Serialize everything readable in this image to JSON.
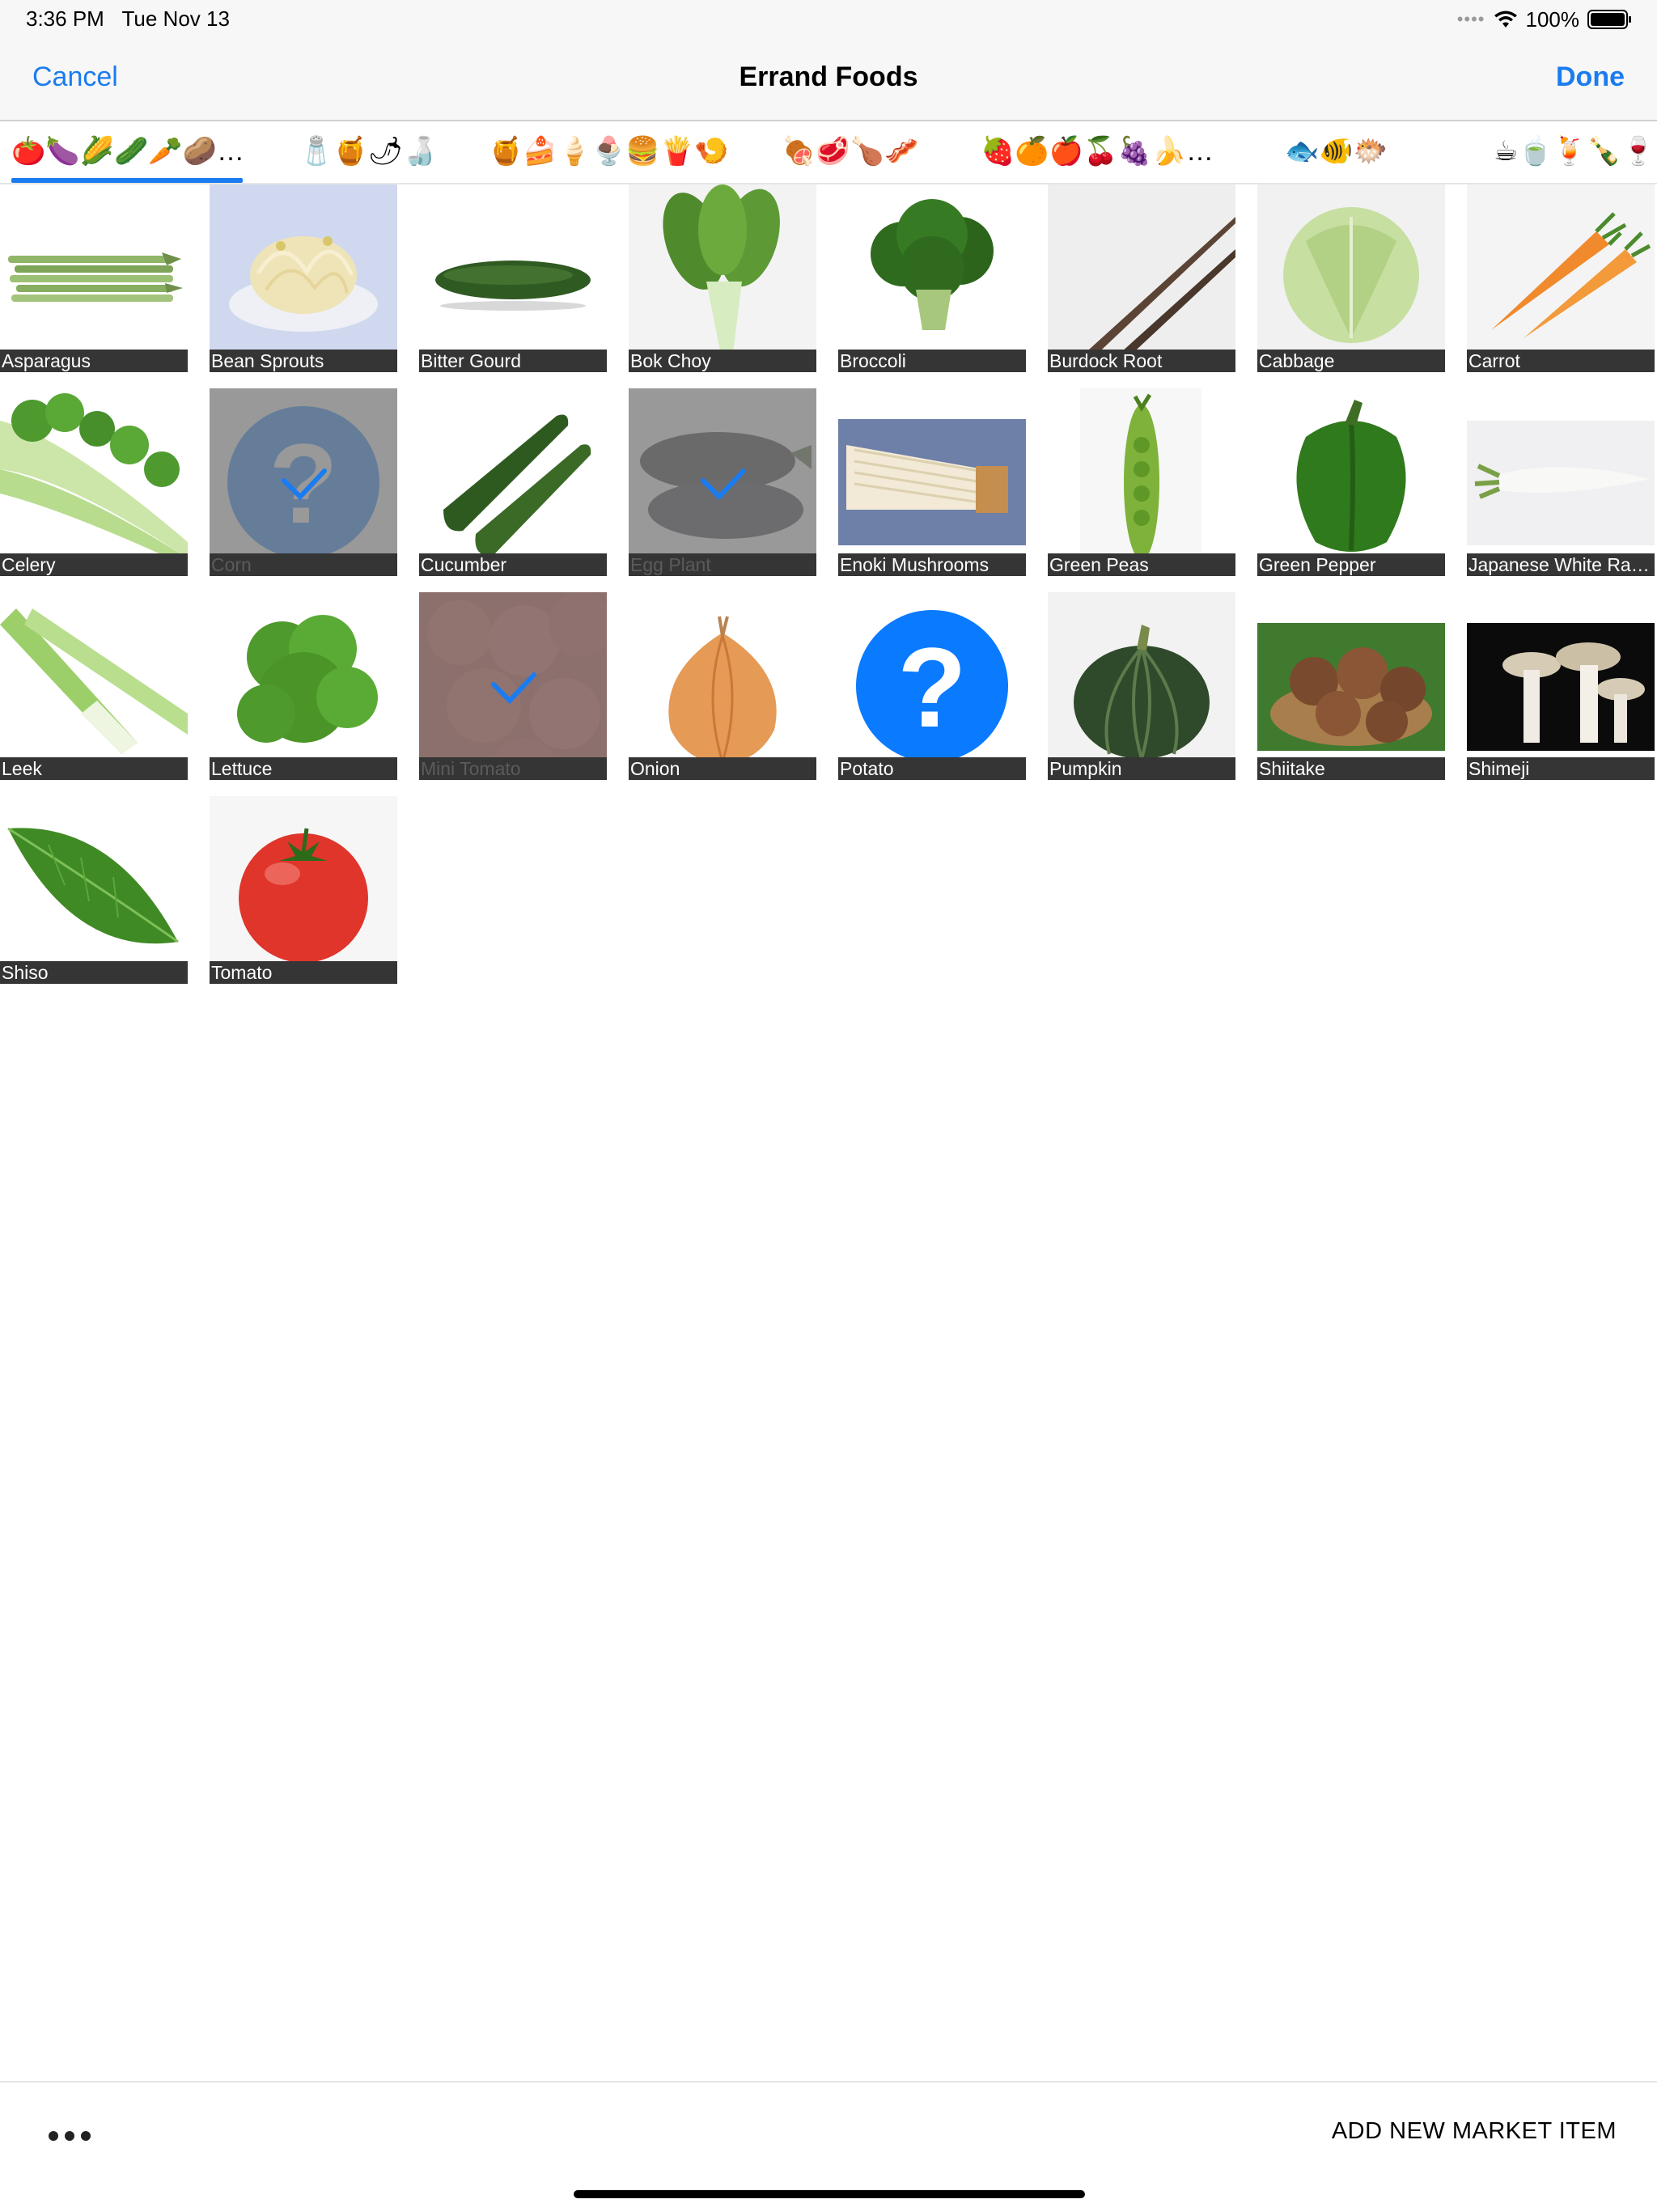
{
  "status": {
    "time": "3:36 PM",
    "date": "Tue Nov 13",
    "battery": "100%"
  },
  "nav": {
    "cancel": "Cancel",
    "title": "Errand Foods",
    "done": "Done"
  },
  "tabs": [
    {
      "label": "🍅🍆🌽🥒🥕🥔…",
      "selected": true
    },
    {
      "label": "🧂🍯🌶🍶"
    },
    {
      "label": "🍯🍰🍦🍨🍔🍟🍤"
    },
    {
      "label": "🍖🥩🍗🥓"
    },
    {
      "label": "🍓🍊🍎🍒🍇🍌…"
    },
    {
      "label": "🐟🐠🐡"
    },
    {
      "label": "☕🍵🍹🍾🍷"
    }
  ],
  "items": [
    {
      "name": "Asparagus",
      "selected": false
    },
    {
      "name": "Bean Sprouts",
      "selected": false
    },
    {
      "name": "Bitter Gourd",
      "selected": false
    },
    {
      "name": "Bok Choy",
      "selected": false
    },
    {
      "name": "Broccoli",
      "selected": false
    },
    {
      "name": "Burdock Root",
      "selected": false
    },
    {
      "name": "Cabbage",
      "selected": false
    },
    {
      "name": "Carrot",
      "selected": false
    },
    {
      "name": "Celery",
      "selected": false
    },
    {
      "name": "Corn",
      "selected": true
    },
    {
      "name": "Cucumber",
      "selected": false
    },
    {
      "name": "Egg Plant",
      "selected": true
    },
    {
      "name": "Enoki Mushrooms",
      "selected": false
    },
    {
      "name": "Green Peas",
      "selected": false
    },
    {
      "name": "Green Pepper",
      "selected": false
    },
    {
      "name": "Japanese White Radish",
      "selected": false
    },
    {
      "name": "Leek",
      "selected": false
    },
    {
      "name": "Lettuce",
      "selected": false
    },
    {
      "name": "Mini Tomato",
      "selected": true
    },
    {
      "name": "Onion",
      "selected": false
    },
    {
      "name": "Potato",
      "selected": false
    },
    {
      "name": "Pumpkin",
      "selected": false
    },
    {
      "name": "Shiitake",
      "selected": false
    },
    {
      "name": "Shimeji",
      "selected": false
    },
    {
      "name": "Shiso",
      "selected": false
    },
    {
      "name": "Tomato",
      "selected": false
    }
  ],
  "toolbar": {
    "add_label": "ADD NEW MARKET ITEM"
  },
  "colors": {
    "accent": "#1a7cf0",
    "label_bg": "#353535",
    "placeholder_blue": "#0a7aff"
  }
}
